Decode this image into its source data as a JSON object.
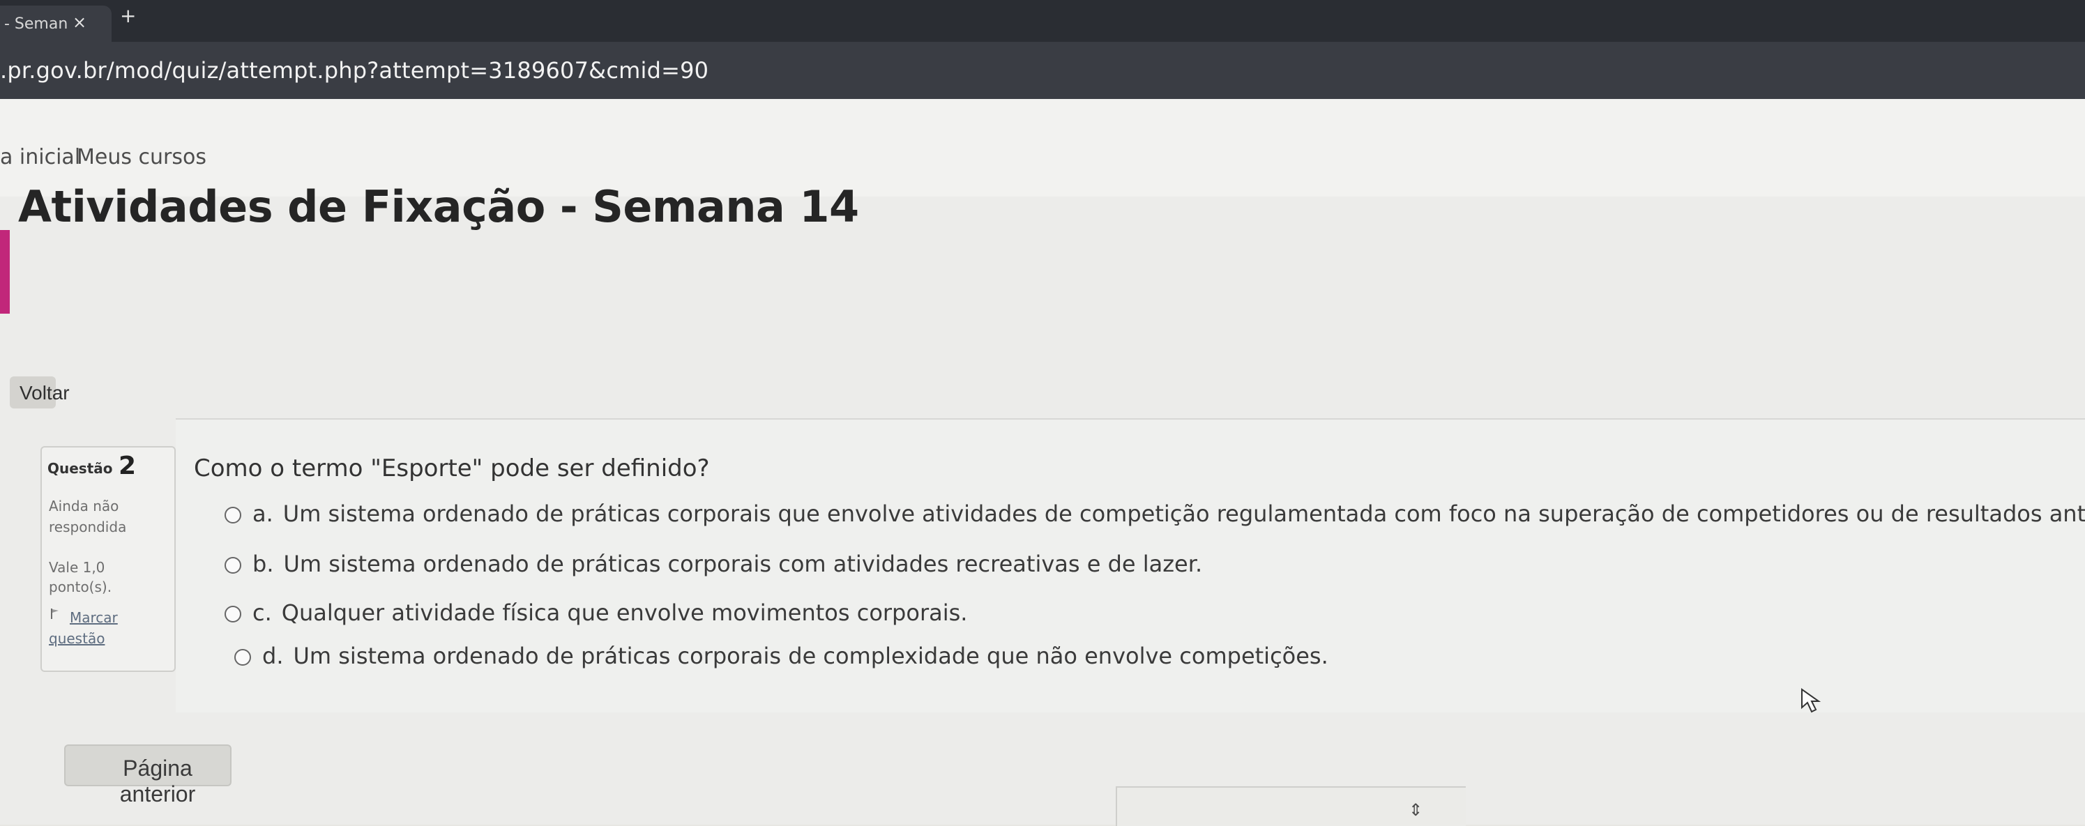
{
  "browser": {
    "tab_title": "- Seman",
    "tab_close": "×",
    "new_tab": "+",
    "url": ".pr.gov.br/mod/quiz/attempt.php?attempt=3189607&cmid=90"
  },
  "navbar": {
    "items": [
      "a inicial",
      "Meus cursos"
    ]
  },
  "page": {
    "title": "Atividades de Fixação - Semana 14",
    "back_label": "Voltar",
    "prev_label": "Página anterior"
  },
  "question": {
    "label": "Questão",
    "number": "2",
    "state_line1": "Ainda não",
    "state_line2": "respondida",
    "grade_line1": "Vale 1,0",
    "grade_line2": "ponto(s).",
    "flag_line1": "Marcar",
    "flag_line2": "questão",
    "text": "Como o termo \"Esporte\" pode ser definido?",
    "options": [
      {
        "letter": "a.",
        "text": "Um sistema ordenado de práticas corporais que envolve atividades de competição regulamentada com foco na superação de competidores ou de resultados anteriores."
      },
      {
        "letter": "b.",
        "text": "Um sistema ordenado de práticas corporais com atividades recreativas e de lazer."
      },
      {
        "letter": "c.",
        "text": "Qualquer atividade física que envolve movimentos corporais."
      },
      {
        "letter": "d.",
        "text": "Um sistema ordenado de práticas corporais de complexidade que não envolve competições."
      }
    ]
  },
  "scroll": {
    "arrows": "⇕"
  },
  "colors": {
    "accent": "#c1277a",
    "link": "#5e6d80",
    "titlebar": "#2a2d33"
  }
}
